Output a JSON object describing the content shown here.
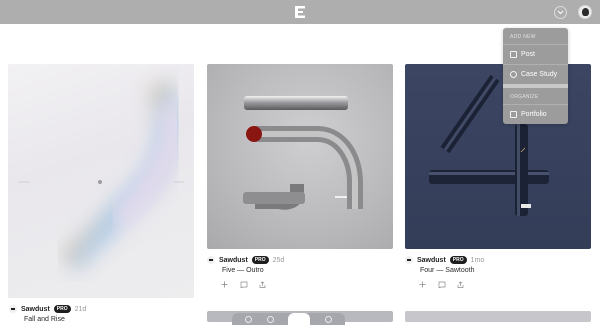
{
  "topbar": {
    "logo_icon": "brand-e-icon",
    "dropdown_icon": "chevron-down-icon",
    "avatar_icon": "user-avatar"
  },
  "menu": {
    "section_add": "ADD NEW",
    "item_post": "Post",
    "item_case_study": "Case Study",
    "section_organize": "ORGANIZE",
    "item_portfolio": "Portfolio"
  },
  "cards": [
    {
      "author": "Sawdust",
      "badge": "PRO",
      "age": "21d",
      "title": "Fall and Rise"
    },
    {
      "author": "Sawdust",
      "badge": "PRO",
      "age": "25d",
      "title": "Five — Outro"
    },
    {
      "author": "Sawdust",
      "badge": "PRO",
      "age": "1mo",
      "title": "Four — Sawtooth"
    }
  ],
  "card_actions": [
    "add-icon",
    "collection-icon",
    "share-icon"
  ],
  "colors": {
    "topbar": "#aeaeae",
    "menu": "#9c9c9c",
    "badge": "#1e1e1e",
    "tube_red": "#8a1612"
  }
}
